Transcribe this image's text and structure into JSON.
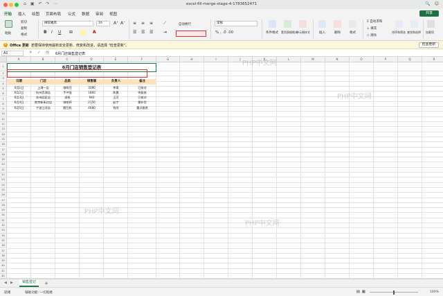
{
  "window": {
    "title": "excel-fill-merge-stage-4-1783652471",
    "quick_icons": [
      "⌂",
      "▣",
      "↶",
      "↷",
      "⋯"
    ],
    "right_icons": [
      "🔍",
      "☺"
    ]
  },
  "menu": {
    "tabs": [
      "开始",
      "插入",
      "绘图",
      "页面布局",
      "公式",
      "数据",
      "审阅",
      "视图"
    ],
    "share": "共享"
  },
  "ribbon": {
    "paste": "粘贴",
    "cut": "剪切",
    "copy": "复制",
    "format_painter": "格式",
    "font_name": "微软雅黑",
    "font_size": "16",
    "wrap_text": "自动换行",
    "merge_center": "合并后居中",
    "number_format": "常规",
    "cond_format": "条件格式",
    "table_format": "套用表格格式",
    "cell_style": "单元格样式",
    "insert": "插入",
    "delete": "删除",
    "format": "格式",
    "autosum": "自动求和",
    "fill": "填充",
    "clear": "清除",
    "sort_filter": "排序和筛选",
    "find_select": "查找和选择",
    "addins": "加载项",
    "accent": "#1d7a44"
  },
  "infobar": {
    "title": "Office 更新",
    "message": "若要保持使用最新安全更新、修复和改进，请选择 \"检查更新\"。",
    "button": "检查更新"
  },
  "formula_bar": {
    "cell_ref": "A1",
    "fx": "fx",
    "content": "6月门店销售登记表"
  },
  "grid": {
    "columns": [
      "A",
      "B",
      "C",
      "D",
      "E",
      "F",
      "G",
      "H",
      "I",
      "J",
      "K",
      "L",
      "M",
      "N",
      "O",
      "P",
      "Q",
      "R",
      "S",
      "T"
    ],
    "rows": [
      "1",
      "2",
      "3",
      "4",
      "5",
      "6",
      "7",
      "8",
      "9",
      "10",
      "11",
      "12",
      "13",
      "14",
      "15",
      "16",
      "17",
      "18",
      "19",
      "20",
      "21",
      "22",
      "23",
      "24",
      "25",
      "26",
      "27",
      "28",
      "29",
      "30",
      "31",
      "32",
      "33",
      "34",
      "35",
      "36",
      "37",
      "38",
      "39",
      "40",
      "41",
      "42",
      "43"
    ]
  },
  "sheet_table": {
    "title": "6月门店销售登记表",
    "headers": [
      "日期",
      "门店",
      "品类",
      "销售额",
      "负责人",
      "备注"
    ],
    "rows": [
      [
        "6月1日",
        "上海一店",
        "咖啡豆",
        "3280",
        "李青",
        "已核对"
      ],
      [
        "6月2日",
        "杭州西湖店",
        "手冲壶",
        "1860",
        "陈晨",
        "待复核"
      ],
      [
        "6月3日",
        "苏州园区店",
        "滤纸",
        "940",
        "王可",
        "已核对"
      ],
      [
        "6月4日",
        "南京新街口店",
        "咖啡杯",
        "2150",
        "赵宁",
        "需补货"
      ],
      [
        "6月5日",
        "宁波江北店",
        "磨豆机",
        "4680",
        "钱亮",
        "重点跟进"
      ]
    ]
  },
  "watermarks": [
    "PHP中文网",
    "PHP中文网",
    "PHP中文网",
    "PHP中文网"
  ],
  "sheets": {
    "active": "销售登记",
    "add": "+"
  },
  "status": {
    "ready": "就绪",
    "accessibility": "辅助功能: 一切就绪",
    "zoom": "100%"
  }
}
